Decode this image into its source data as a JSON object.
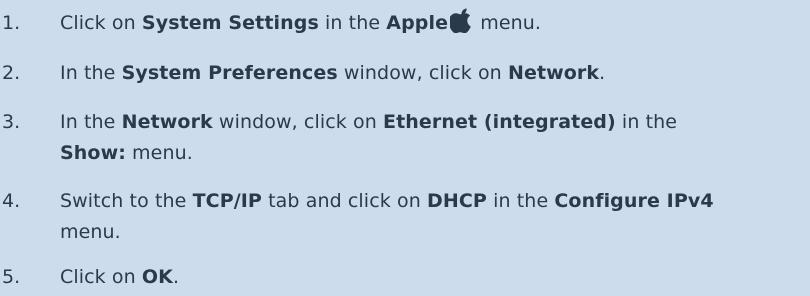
{
  "steps": [
    {
      "number": "1.",
      "parts": {
        "a": "Click on ",
        "b": "System Settings",
        "c": " in the ",
        "d": "Apple",
        "e": " menu."
      },
      "icon": "apple-logo-icon"
    },
    {
      "number": "2.",
      "parts": {
        "a": "In the ",
        "b": "System Preferences",
        "c": " window, click on ",
        "d": "Network",
        "e": "."
      }
    },
    {
      "number": "3.",
      "parts": {
        "a": "In the ",
        "b": "Network",
        "c": " window, click on ",
        "d": "Ethernet (integrated)",
        "e": " in the ",
        "f": "Show:",
        "g": " menu."
      }
    },
    {
      "number": "4.",
      "parts": {
        "a": "Switch to the ",
        "b": "TCP/IP",
        "c": " tab and click on ",
        "d": "DHCP",
        "e": " in the ",
        "f": "Configure IPv4",
        "g": " menu."
      }
    },
    {
      "number": "5.",
      "parts": {
        "a": "Click on ",
        "b": "OK",
        "c": "."
      }
    }
  ],
  "colors": {
    "background": "#ccdcec",
    "text": "#2a3a4d"
  }
}
